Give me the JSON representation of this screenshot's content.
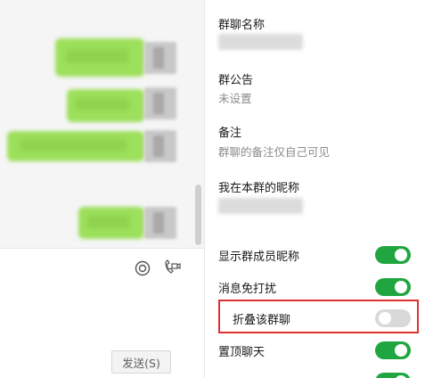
{
  "send_button": {
    "label": "发送(S)"
  },
  "group_name": {
    "title": "群聊名称"
  },
  "announcement": {
    "title": "群公告",
    "value": "未设置"
  },
  "remark": {
    "title": "备注",
    "placeholder": "群聊的备注仅自己可见"
  },
  "my_nickname": {
    "title": "我在本群的昵称"
  },
  "toggles": [
    {
      "label": "显示群成员昵称",
      "on": true
    },
    {
      "label": "消息免打扰",
      "on": true
    },
    {
      "label": "折叠该群聊",
      "on": false
    },
    {
      "label": "置顶聊天",
      "on": true
    }
  ],
  "colors": {
    "toggle_on": "#20a640",
    "toggle_off": "#d9d9d9",
    "highlight": "#e03131",
    "bubble": "#9de05c"
  },
  "icons": {
    "emoji": "target-icon",
    "video_call": "video-call-icon"
  }
}
